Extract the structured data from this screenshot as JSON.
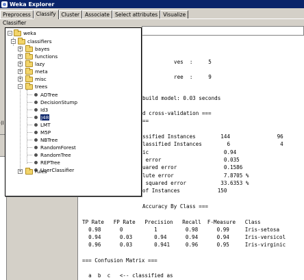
{
  "window": {
    "title": "Weka Explorer"
  },
  "tabs": [
    {
      "label": "Preprocess",
      "active": false
    },
    {
      "label": "Classify",
      "active": true
    },
    {
      "label": "Cluster",
      "active": false
    },
    {
      "label": "Associate",
      "active": false
    },
    {
      "label": "Select attributes",
      "active": false
    },
    {
      "label": "Visualize",
      "active": false
    }
  ],
  "classifier_section": {
    "label": "Classifier"
  },
  "left_panel": {
    "marker": "(l"
  },
  "tree": {
    "root": "weka",
    "classifiers": "classifiers",
    "groups": {
      "bayes": "bayes",
      "functions": "functions",
      "lazy": "lazy",
      "meta": "meta",
      "misc": "misc",
      "trees": "trees",
      "rules": "rules"
    },
    "trees_items": [
      "ADTree",
      "DecisionStump",
      "Id3",
      "J48",
      "LMT",
      "M5P",
      "NBTree",
      "RandomForest",
      "RandomTree",
      "REPTree",
      "UserClassifier"
    ],
    "selected": "J48"
  },
  "output_lines": [
    "ves  :     5",
    "ree  :     9",
    "build model: 0.03 seconds",
    "d cross-validation ===",
    "==",
    "ssified Instances        144               96",
    "lassified Instances        6                4",
    "ic                        0.94",
    " error                    0.035",
    "uared error               0.1586",
    "lute error                7.8705 %",
    " squared error           33.6353 %",
    "of Instances            150",
    "Accuracy By Class ===",
    "TP Rate   FP Rate   Precision   Recall  F-Measure   Class",
    "  0.98      0          1         0.98      0.99     Iris-setosa",
    "  0.94      0.03       0.94      0.94      0.94     Iris-versicol",
    "  0.96      0.03       0.941     0.96      0.95     Iris-virginic",
    "=== Confusion Matrix ===",
    "  a  b  c   <-- classified as"
  ]
}
